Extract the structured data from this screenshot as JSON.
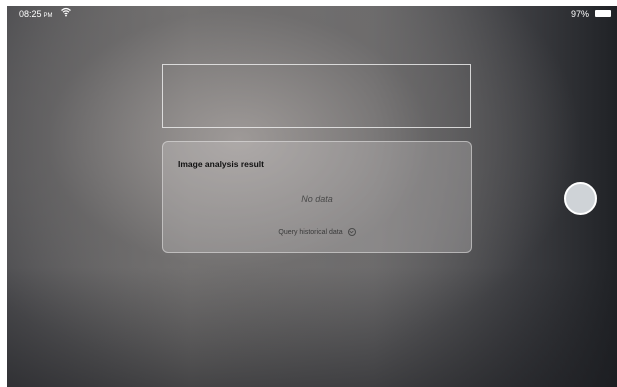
{
  "status_bar": {
    "time": "08:25",
    "ampm": "PM",
    "battery_percent": "97%",
    "wifi_icon": "wifi-icon",
    "battery_icon": "battery-icon"
  },
  "result_card": {
    "title": "Image analysis result",
    "empty_text": "No data",
    "query_label": "Query historical data",
    "query_icon": "chevron-down-circle-icon"
  },
  "shutter": {
    "icon": "shutter-button"
  }
}
